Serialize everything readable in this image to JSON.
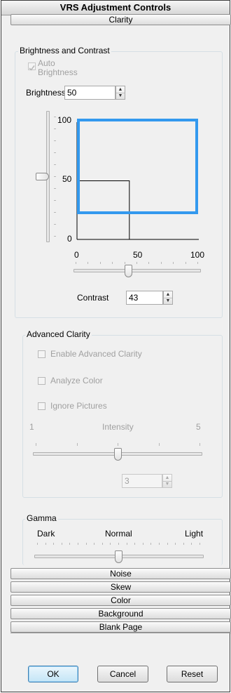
{
  "window": {
    "title": "VRS Adjustment Controls"
  },
  "sections": {
    "clarity": "Clarity",
    "noise": "Noise",
    "skew": "Skew",
    "color": "Color",
    "background": "Background",
    "blank_page": "Blank Page"
  },
  "brightness_contrast": {
    "group_label": "Brightness and Contrast",
    "auto_brightness_label_1": "Auto",
    "auto_brightness_label_2": "Brightness",
    "auto_brightness_checked": true,
    "brightness_label": "Brightness",
    "brightness_value": "50",
    "brightness_slider_label_top": "100",
    "brightness_slider_label_mid": "50",
    "graph_y_top": "100",
    "graph_y_mid": "50",
    "graph_y_zero": "0",
    "graph_x_0": "0",
    "graph_x_50": "50",
    "graph_x_100": "100",
    "contrast_label": "Contrast",
    "contrast_value": "43",
    "brightness_level": 50,
    "contrast_level": 43,
    "box_color": "#3399ee"
  },
  "advanced_clarity": {
    "group_label": "Advanced Clarity",
    "enable_label": "Enable Advanced Clarity",
    "analyze_color_label": "Analyze Color",
    "ignore_pictures_label": "Ignore Pictures",
    "intensity_min": "1",
    "intensity_label": "Intensity",
    "intensity_max": "5",
    "intensity_value": "3",
    "intensity_level": 3
  },
  "gamma": {
    "group_label": "Gamma",
    "dark_label": "Dark",
    "normal_label": "Normal",
    "light_label": "Light",
    "gamma_level": 0.5
  },
  "buttons": {
    "ok": "OK",
    "cancel": "Cancel",
    "reset": "Reset"
  }
}
